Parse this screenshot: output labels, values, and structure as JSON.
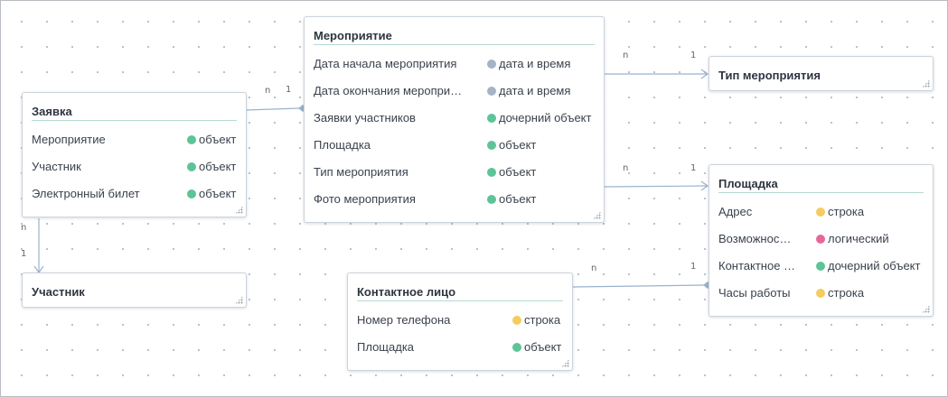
{
  "colors": {
    "object": "#5dc497",
    "datetime": "#a4b3c6",
    "string": "#f4cc5f",
    "boolean": "#e8679a",
    "line": "#9ab2cc"
  },
  "entities": {
    "zayavka": {
      "title": "Заявка",
      "fields": [
        {
          "name": "Мероприятие",
          "type": "объект",
          "kind": "object"
        },
        {
          "name": "Участник",
          "type": "объект",
          "kind": "object"
        },
        {
          "name": "Электронный билет",
          "type": "объект",
          "kind": "object"
        }
      ]
    },
    "uchastnik": {
      "title": "Участник",
      "fields": []
    },
    "meropriyatie": {
      "title": "Мероприятие",
      "fields": [
        {
          "name": "Дата начала мероприятия",
          "type": "дата и время",
          "kind": "datetime"
        },
        {
          "name": "Дата окончания меропри…",
          "type": "дата и время",
          "kind": "datetime"
        },
        {
          "name": "Заявки участников",
          "type": "дочерний объект",
          "kind": "object"
        },
        {
          "name": "Площадка",
          "type": "объект",
          "kind": "object"
        },
        {
          "name": "Тип мероприятия",
          "type": "объект",
          "kind": "object"
        },
        {
          "name": "Фото мероприятия",
          "type": "объект",
          "kind": "object"
        }
      ]
    },
    "tip": {
      "title": "Тип мероприятия",
      "fields": []
    },
    "ploshchadka": {
      "title": "Площадка",
      "fields": [
        {
          "name": "Адрес",
          "type": "строка",
          "kind": "string"
        },
        {
          "name": "Возможнос…",
          "type": "логический",
          "kind": "boolean"
        },
        {
          "name": "Контактное …",
          "type": "дочерний объект",
          "kind": "object"
        },
        {
          "name": "Часы работы",
          "type": "строка",
          "kind": "string"
        }
      ]
    },
    "kontakt": {
      "title": "Контактное лицо",
      "fields": [
        {
          "name": "Номер телефона",
          "type": "строка",
          "kind": "string"
        },
        {
          "name": "Площадка",
          "type": "объект",
          "kind": "object"
        }
      ]
    }
  },
  "relations": [
    {
      "id": "zayavka-meropriyatie",
      "from_label": "n",
      "to_label": "1"
    },
    {
      "id": "zayavka-uchastnik",
      "from_label": "n",
      "to_label": "1"
    },
    {
      "id": "meropriyatie-tip",
      "from_label": "n",
      "to_label": "1"
    },
    {
      "id": "meropriyatie-ploshchadka",
      "from_label": "n",
      "to_label": "1"
    },
    {
      "id": "kontakt-ploshchadka",
      "from_label": "n",
      "to_label": "1"
    }
  ]
}
